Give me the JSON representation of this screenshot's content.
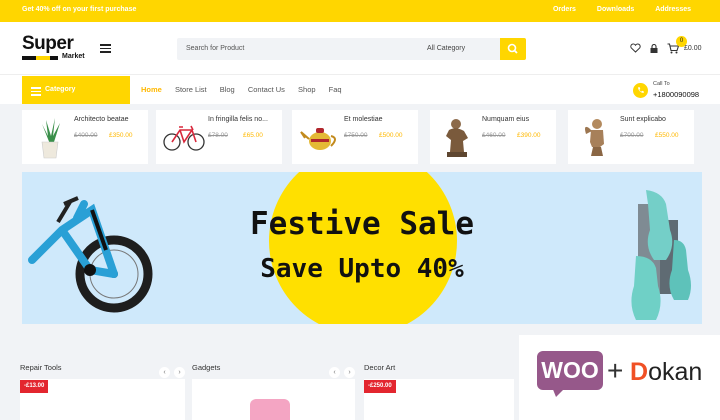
{
  "topbar": {
    "promo": "Get 40% off on your first purchase",
    "links": [
      "Orders",
      "Downloads",
      "Addresses"
    ]
  },
  "header": {
    "logo_main": "Super",
    "logo_sub": "Market",
    "search_placeholder": "Search for Product",
    "search_category": "All Category",
    "cart_count": "0",
    "cart_total": "£0.00"
  },
  "nav": {
    "category_label": "Category",
    "items": [
      "Home",
      "Store List",
      "Blog",
      "Contact Us",
      "Shop",
      "Faq"
    ],
    "call_label": "Call To",
    "call_number": "+1800090098"
  },
  "products": [
    {
      "name": "Architecto beatae",
      "old_price": "£400.00",
      "new_price": "£350.00",
      "icon": "plant-image"
    },
    {
      "name": "In fringilla felis no...",
      "old_price": "£78.00",
      "new_price": "£65.00",
      "icon": "bicycle-image"
    },
    {
      "name": "Et molestiae",
      "old_price": "£750.00",
      "new_price": "£500.00",
      "icon": "teapot-image"
    },
    {
      "name": "Numquam eius",
      "old_price": "£460.00",
      "new_price": "£390.00",
      "icon": "statue-image"
    },
    {
      "name": "Sunt explicabo",
      "old_price": "£700.00",
      "new_price": "£550.00",
      "icon": "cherub-statue-image"
    }
  ],
  "banner": {
    "title": "Festive Sale",
    "subtitle": "Save Upto 40%"
  },
  "sections": [
    {
      "title": "Repair Tools",
      "tag": "-£13.00"
    },
    {
      "title": "Gadgets",
      "tag": ""
    },
    {
      "title": "Decor Art",
      "tag": "-£250.00"
    }
  ],
  "branding": {
    "woo": "WOO",
    "plus": "+",
    "dokan_d": "D",
    "dokan_rest": "okan"
  },
  "colors": {
    "accent": "#ffd600",
    "price": "#ffb800",
    "sale_tag": "#e3262f",
    "banner_bg": "#cfe9fb",
    "woo": "#96588a",
    "dokan": "#f05025"
  }
}
